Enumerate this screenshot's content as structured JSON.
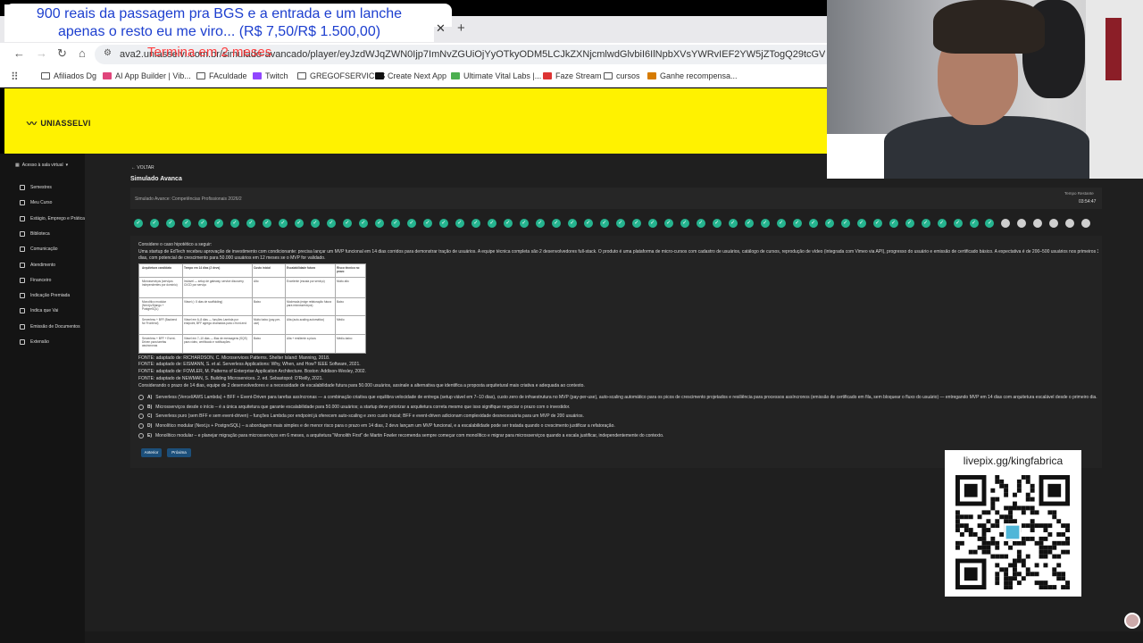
{
  "overlay": {
    "line1": "900 reais da passagem pra BGS e a entrada e um lanche",
    "line2": "apenas o resto eu me viro... (R$ 7,50/R$ 1.500,00)",
    "timer_text": "Termina em 2 meses"
  },
  "browser": {
    "url": "ava2.uniasselvi.com.br/simulado-avancado/player/eyJzdWJqZWN0Ijp7ImNvZGUiOjYyOTkyODM5LCJkZXNjcmlwdGlvbiI6IlNpbXVsYWRvIEF2YW5jZTogQ29tcGV0w6puY2lhcyBQcm9maXNzaW9uYWlz",
    "bookmarks": [
      {
        "label": "Afiliados Dg",
        "icon": "folder-icon"
      },
      {
        "label": "AI App Builder | Vib...",
        "icon": "heart-icon",
        "color": "#e0457b"
      },
      {
        "label": "FAculdade",
        "icon": "folder-icon"
      },
      {
        "label": "Twitch",
        "icon": "twitch-icon",
        "color": "#9146ff"
      },
      {
        "label": "GREGOFSERVICES",
        "icon": "folder-icon"
      },
      {
        "label": "Create Next App",
        "icon": "globe-icon",
        "color": "#111111"
      },
      {
        "label": "Ultimate Vital Labs |...",
        "icon": "leaf-icon",
        "color": "#4caf50"
      },
      {
        "label": "Faze Stream",
        "icon": "stream-icon",
        "color": "#d33"
      },
      {
        "label": "cursos",
        "icon": "folder-icon"
      },
      {
        "label": "Ganhe recompensa...",
        "icon": "gift-icon",
        "color": "#d67b00"
      }
    ]
  },
  "site": {
    "logo": "UNIASSELVI",
    "banner_color": "#fff200"
  },
  "sidebar": {
    "header": "Acesso à sala virtual",
    "items": [
      {
        "label": "Semestres"
      },
      {
        "label": "Meu Curso"
      },
      {
        "label": "Estágio, Emprego e Práticas"
      },
      {
        "label": "Biblioteca"
      },
      {
        "label": "Comunicação"
      },
      {
        "label": "Atendimento"
      },
      {
        "label": "Financeiro"
      },
      {
        "label": "Indicação Premiada"
      },
      {
        "label": "Indica que Vai"
      },
      {
        "label": "Emissão de Documentos"
      },
      {
        "label": "Extensão"
      }
    ]
  },
  "main": {
    "back": "← VOLTAR",
    "title": "Simulado Avanca",
    "subtitle": "Simulado Avance: Competências Profissionais 2026/2",
    "time_label": "Tempo Restante",
    "time_value": "03:54:47",
    "progress": {
      "answered": 54,
      "total": 60
    },
    "question": {
      "intro": "Considere o caso hipotético a seguir:",
      "line1": "Uma startup de EdTech recebeu aprovação de investimento com condicionante: precisa lançar um MVP funcional em 14 dias corridos para demonstrar tração de usuários. A equipe técnica completa são 2 desenvolvedores full-stack. O produto é uma plataforma de micro-cursos com cadastro de usuários, catálogo de cursos, reprodução de vídeo (integrada com Vimeo via API), progresso do usuário e emissão de certificado básico. A expectativa é de 200–500 usuários nos primeiros 30",
      "line2": "dias, com potencial de crescimento para 50.000 usuários em 12 meses se o MVP for validado.",
      "table": {
        "headers": [
          "Arquitetura candidata",
          "Tempo em 14 dias (2 devs)",
          "Custo inicial",
          "Escalabilidade futura",
          "Risco técnico no prazo"
        ],
        "rows": [
          [
            "Microsserviços (serviços independentes por domínio)",
            "Inviável — setup de gateway, service discovery, CI/CD por serviço",
            "Alto",
            "Excelente (escala por serviço)",
            "Muito alto"
          ],
          [
            "Monolítico modular (Next.js/Django + PostgreSQL)",
            "Viável (≈ 5 dias de scaffolding)",
            "Baixo",
            "Moderada (exige refatoração futura para microsserviços)",
            "Baixo"
          ],
          [
            "Serverless + BFF (Backend for Frontend)",
            "Viável em 6–8 dias — funções Lambda por endpoint, BFF agrega chamadas para o front-end",
            "Muito baixo (pay-per-use)",
            "Alta (auto-scaling automático)",
            "Médio"
          ],
          [
            "Serverless + BFF + Event-Driven para tarefas assíncronas",
            "Viável em 7–10 dias — filas de mensagens (SQS) para vídeo, certificado e notificações",
            "Baixo",
            "Alta + resiliente a picos",
            "Médio-baixo"
          ]
        ]
      },
      "sources": [
        "FONTE: adaptado de: RICHARDSON, C. Microservices Patterns. Shelter Island: Manning, 2018.",
        "FONTE: adaptado de: EISMANN, S. et al. Serverless Applications: Why, When, and How? IEEE Software, 2021.",
        "FONTE: adaptado de: FOWLER, M. Patterns of Enterprise Application Architecture. Boston: Addison-Wesley, 2002.",
        "FONTE: adaptado de NEWMAN, S. Building Microservices. 2. ed. Sebastopol: O'Reilly, 2021."
      ],
      "prompt": "Considerando o prazo de 14 dias, equipe de 2 desenvolvedores e a necessidade de escalabilidade futura para 50.000 usuários, assinale a alternativa que identifica a proposta arquitetural mais criativa e adequada ao contexto.",
      "options": [
        {
          "letter": "A)",
          "text": "Serverless (Vercel/AWS Lambda) + BFF + Event-Driven para tarefas assíncronas — a combinação criativa que equilibra velocidade de entrega (setup viável em 7–10 dias), custo zero de infraestrutura no MVP (pay-per-use), auto-scaling automático para os picos de crescimento projetados e resiliência para processos assíncronos (emissão de certificado em fila, sem bloquear o fluxo do usuário) — entregando MVP em 14 dias com arquitetura escalável desde o primeiro dia."
        },
        {
          "letter": "B)",
          "text": "Microsserviços desde o início – é a única arquitetura que garante escalabilidade para 50.000 usuários; a startup deve priorizar a arquitetura correta mesmo que isso signifique negociar o prazo com o investidor."
        },
        {
          "letter": "C)",
          "text": "Serverless puro (sem BFF e sem event-driven) – funções Lambda por endpoint já oferecem auto-scaling e zero custo inicial; BFF e event-driven adicionam complexidade desnecessária para um MVP de 200 usuários."
        },
        {
          "letter": "D)",
          "text": "Monolítico modular (Next.js + PostgreSQL) – a abordagem mais simples e de menor risco para o prazo em 14 dias, 2 devs lançam um MVP funcional, e a escalabilidade pode ser tratada quando o crescimento justificar a refatoração."
        },
        {
          "letter": "E)",
          "text": "Monolítico modular – e planejar migração para microsserviços em 6 meses, a arquitetura \"Monolith First\" de Martin Fowler recomenda sempre começar com monolítico e migrar para microsserviços quando a escala justificar, independentemente do contexto."
        }
      ]
    },
    "buttons": {
      "prev": "Anterior",
      "next": "Próxima"
    },
    "accent": "#25b48f"
  },
  "qr": {
    "label": "livepix.gg/kingfabrica"
  }
}
